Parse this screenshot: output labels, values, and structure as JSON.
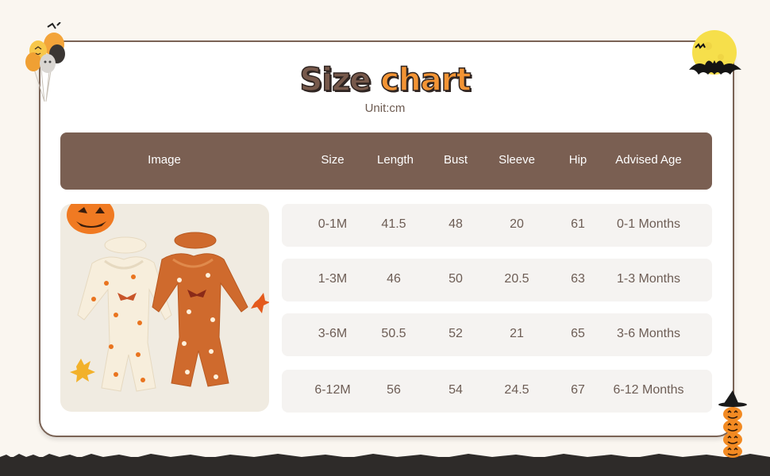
{
  "title": {
    "word1": "Size",
    "word2": "chart"
  },
  "unit": "Unit:cm",
  "table": {
    "headers": [
      "Image",
      "Size",
      "Length",
      "Bust",
      "Sleeve",
      "Hip",
      "Advised Age"
    ],
    "rows": [
      [
        "0-1M",
        "41.5",
        "48",
        "20",
        "61",
        "0-1 Months"
      ],
      [
        "1-3M",
        "46",
        "50",
        "20.5",
        "63",
        "1-3 Months"
      ],
      [
        "3-6M",
        "50.5",
        "52",
        "21",
        "65",
        "3-6 Months"
      ],
      [
        "6-12M",
        "56",
        "54",
        "24.5",
        "67",
        "6-12 Months"
      ]
    ]
  },
  "colors": {
    "header_bg": "#7a5f52",
    "title_brown": "#77594b",
    "title_orange": "#f39434",
    "row_bg": "#f5f3f1"
  },
  "icons": [
    "balloons-icon",
    "moon-bat-icon",
    "pumpkin-stack-icon",
    "jack-o-lantern-icon",
    "maple-leaf-icon"
  ]
}
